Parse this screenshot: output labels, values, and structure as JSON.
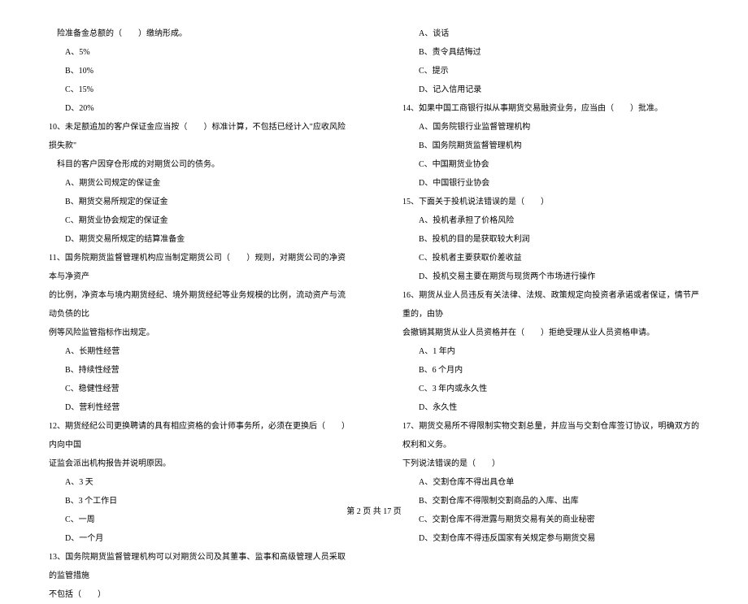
{
  "left": {
    "q9_cont": "险准备金总额的（　　）缴纳形成。",
    "q9_opts": [
      "A、5%",
      "B、10%",
      "C、15%",
      "D、20%"
    ],
    "q10": "10、未足额追加的客户保证金应当按（　　）标准计算，不包括已经计入\"应收风险损失款\"",
    "q10_cont": "科目的客户因穿仓形成的对期货公司的债务。",
    "q10_opts": [
      "A、期货公司规定的保证金",
      "B、期货交易所规定的保证金",
      "C、期货业协会规定的保证金",
      "D、期货交易所规定的结算准备金"
    ],
    "q11": "11、国务院期货监督管理机构应当制定期货公司（　　）规则，对期货公司的净资本与净资产",
    "q11_cont1": "的比例，净资本与境内期货经纪、境外期货经纪等业务规模的比例，流动资产与流动负债的比",
    "q11_cont2": "例等风险监管指标作出规定。",
    "q11_opts": [
      "A、长期性经营",
      "B、持续性经营",
      "C、稳健性经营",
      "D、营利性经营"
    ],
    "q12": "12、期货经纪公司更换聘请的具有相应资格的会计师事务所，必须在更换后（　　）内向中国",
    "q12_cont": "证监会派出机构报告并说明原因。",
    "q12_opts": [
      "A、3 天",
      "B、3 个工作日",
      "C、一周",
      "D、一个月"
    ],
    "q13": "13、国务院期货监督管理机构可以对期货公司及其董事、监事和高级管理人员采取的监管措施",
    "q13_cont": "不包括（　　）"
  },
  "right": {
    "q13_opts": [
      "A、谈话",
      "B、责令具结悔过",
      "C、提示",
      "D、记入信用记录"
    ],
    "q14": "14、如果中国工商银行拟从事期货交易融资业务，应当由（　　）批准。",
    "q14_opts": [
      "A、国务院银行业监督管理机构",
      "B、国务院期货监督管理机构",
      "C、中国期货业协会",
      "D、中国银行业协会"
    ],
    "q15": "15、下面关于投机说法错误的是（　　）",
    "q15_opts": [
      "A、投机者承担了价格风险",
      "B、投机的目的是获取较大利润",
      "C、投机者主要获取价差收益",
      "D、投机交易主要在期货与现货两个市场进行操作"
    ],
    "q16": "16、期货从业人员违反有关法律、法规、政策规定向投资者承诺或者保证，情节严重的，由协",
    "q16_cont": "会撤销其期货从业人员资格并在（　　）拒绝受理从业人员资格申请。",
    "q16_opts": [
      "A、1 年内",
      "B、6 个月内",
      "C、3 年内或永久性",
      "D、永久性"
    ],
    "q17": "17、期货交易所不得限制实物交割总量，并应当与交割仓库签订协议，明确双方的权利和义务。",
    "q17_cont": "下列说法错误的是（　　）",
    "q17_opts": [
      "A、交割仓库不得出具仓单",
      "B、交割仓库不得限制交割商品的入库、出库",
      "C、交割仓库不得泄露与期货交易有关的商业秘密",
      "D、交割仓库不得违反国家有关规定参与期货交易"
    ]
  },
  "footer": "第 2 页 共 17 页"
}
